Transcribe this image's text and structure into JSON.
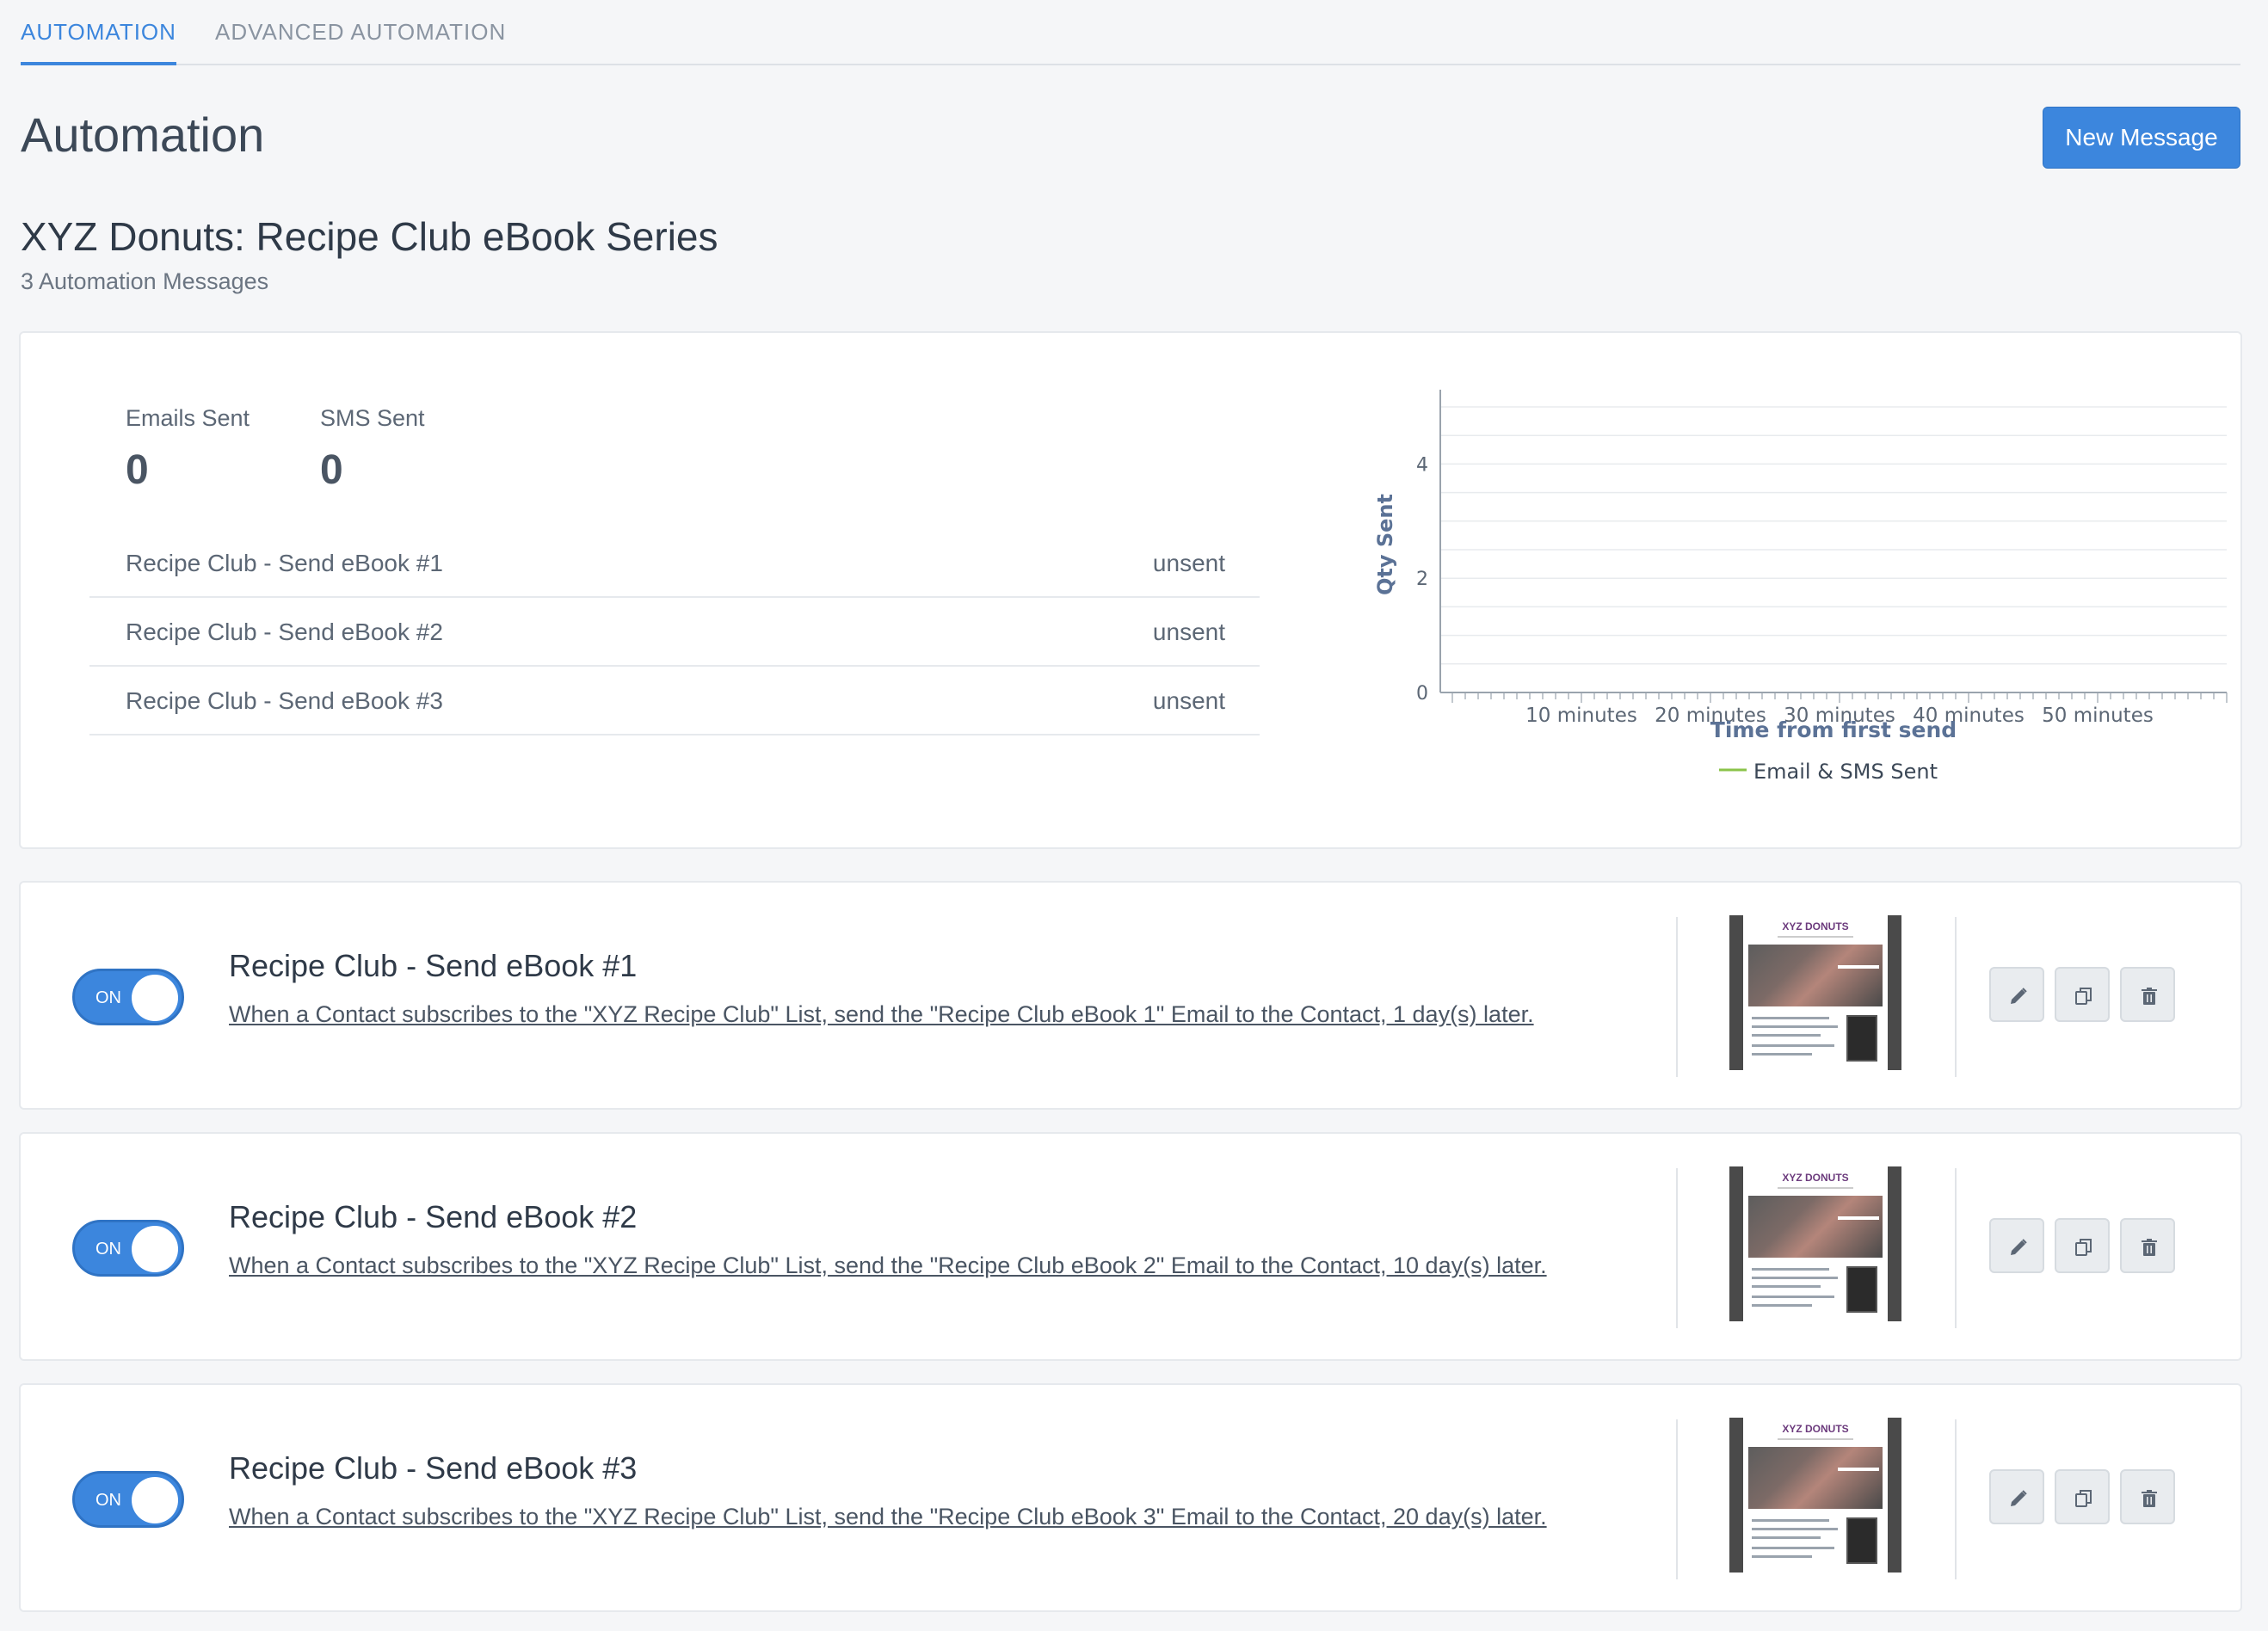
{
  "tabs": [
    {
      "label": "AUTOMATION",
      "active": true
    },
    {
      "label": "ADVANCED AUTOMATION",
      "active": false
    }
  ],
  "header": {
    "title": "Automation",
    "new_button": "New Message"
  },
  "series": {
    "title": "XYZ Donuts: Recipe Club eBook Series",
    "subtitle": "3 Automation Messages"
  },
  "stats": {
    "emails_label": "Emails Sent",
    "emails_value": "0",
    "sms_label": "SMS Sent",
    "sms_value": "0",
    "messages": [
      {
        "name": "Recipe Club - Send eBook #1",
        "status": "unsent"
      },
      {
        "name": "Recipe Club - Send eBook #2",
        "status": "unsent"
      },
      {
        "name": "Recipe Club - Send eBook #3",
        "status": "unsent"
      }
    ]
  },
  "chart_data": {
    "type": "line",
    "ylabel": "Qty Sent",
    "xlabel": "Time from first send",
    "yticks": [
      "0",
      "2",
      "4"
    ],
    "ylim": [
      0,
      5
    ],
    "xticks": [
      "10 minutes",
      "20 minutes",
      "30 minutes",
      "40 minutes",
      "50 minutes"
    ],
    "grid": true,
    "series": [
      {
        "name": "Email & SMS Sent",
        "values": []
      }
    ],
    "legend_position": "bottom",
    "series_color": "#8bc34a"
  },
  "automations": [
    {
      "toggle": "ON",
      "title": "Recipe Club - Send eBook #1",
      "description": "When a Contact subscribes to the \"XYZ Recipe Club\" List, send the \"Recipe Club eBook 1\" Email to the Contact, 1 day(s) later.",
      "thumb_logo": "XYZ DONUTS"
    },
    {
      "toggle": "ON",
      "title": "Recipe Club - Send eBook #2",
      "description": "When a Contact subscribes to the \"XYZ Recipe Club\" List, send the \"Recipe Club eBook 2\" Email to the Contact, 10 day(s) later.",
      "thumb_logo": "XYZ DONUTS"
    },
    {
      "toggle": "ON",
      "title": "Recipe Club - Send eBook #3",
      "description": "When a Contact subscribes to the \"XYZ Recipe Club\" List, send the \"Recipe Club eBook 3\" Email to the Contact, 20 day(s) later.",
      "thumb_logo": "XYZ DONUTS"
    }
  ],
  "icons": {
    "edit": "pencil-icon",
    "copy": "copy-icon",
    "delete": "trash-icon"
  },
  "colors": {
    "accent": "#3c86dd",
    "legend_line": "#8bc34a"
  }
}
